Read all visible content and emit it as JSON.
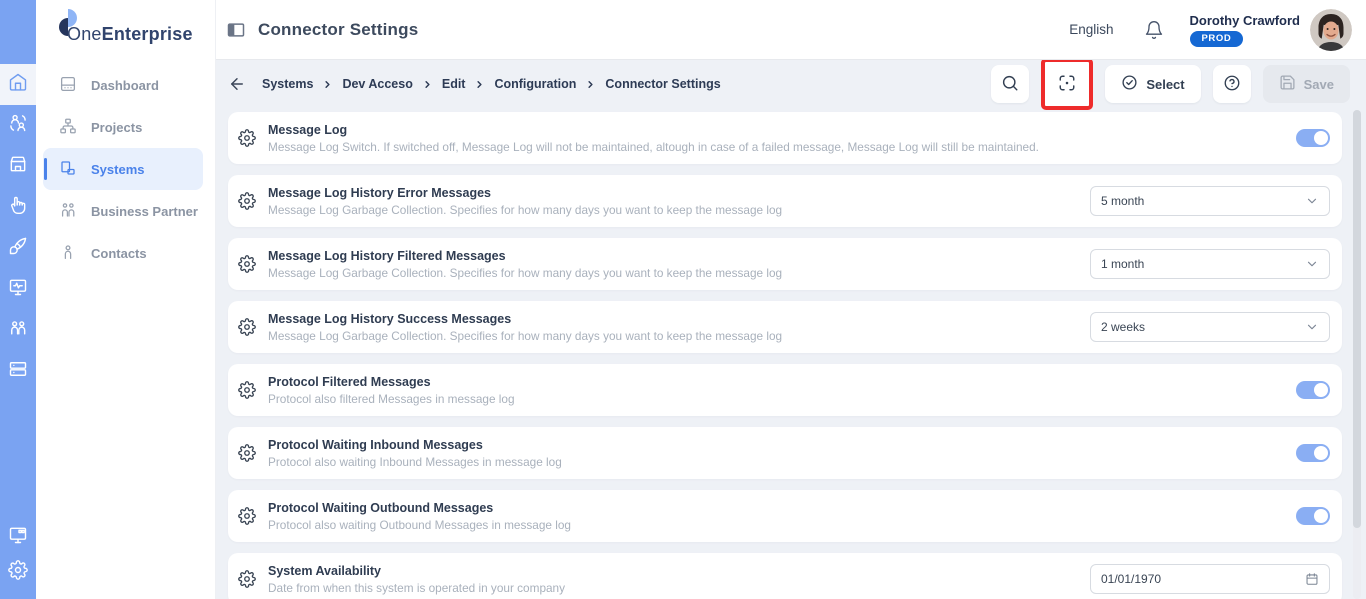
{
  "brand": {
    "name_regular": "One",
    "name_bold": "Enterprise"
  },
  "rail": {
    "items": [
      {
        "icon": "home-icon",
        "active": true
      },
      {
        "icon": "share-users-icon",
        "active": false
      },
      {
        "icon": "store-icon",
        "active": false
      },
      {
        "icon": "hand-pointer-icon",
        "active": false
      },
      {
        "icon": "brush-icon",
        "active": false
      },
      {
        "icon": "monitor-pulse-icon",
        "active": false
      },
      {
        "icon": "users-icon",
        "active": false
      },
      {
        "icon": "server-icon",
        "active": false
      }
    ],
    "bottom_items": [
      {
        "icon": "monitor-apps-icon"
      },
      {
        "icon": "gear-icon"
      }
    ]
  },
  "sidebar": {
    "items": [
      {
        "label": "Dashboard",
        "icon": "dashboard-icon",
        "active": false
      },
      {
        "label": "Projects",
        "icon": "projects-icon",
        "active": false
      },
      {
        "label": "Systems",
        "icon": "systems-icon",
        "active": true
      },
      {
        "label": "Business Partner",
        "icon": "business-partner-icon",
        "active": false
      },
      {
        "label": "Contacts",
        "icon": "contacts-icon",
        "active": false
      }
    ]
  },
  "header": {
    "title": "Connector Settings",
    "language": "English",
    "user": {
      "name": "Dorothy Crawford",
      "badge": "PROD"
    }
  },
  "toolbar": {
    "breadcrumb": [
      "Systems",
      "Dev Acceso",
      "Edit",
      "Configuration",
      "Connector Settings"
    ],
    "select_label": "Select",
    "save_label": "Save",
    "save_disabled": true,
    "annotated_button": "focus-button"
  },
  "settings": {
    "rows": [
      {
        "title": "Message Log",
        "description": "Message Log Switch. If switched off, Message Log will not be maintained, altough in case of a failed message, Message Log will still be maintained.",
        "control": "toggle",
        "value": true
      },
      {
        "title": "Message Log History Error Messages",
        "description": "Message Log Garbage Collection. Specifies for how many days you want to keep the message log",
        "control": "select",
        "value": "5 month"
      },
      {
        "title": "Message Log History Filtered Messages",
        "description": "Message Log Garbage Collection. Specifies for how many days you want to keep the message log",
        "control": "select",
        "value": "1 month"
      },
      {
        "title": "Message Log History Success Messages",
        "description": "Message Log Garbage Collection. Specifies for how many days you want to keep the message log",
        "control": "select",
        "value": "2 weeks"
      },
      {
        "title": "Protocol Filtered Messages",
        "description": "Protocol also filtered Messages in message log",
        "control": "toggle",
        "value": true
      },
      {
        "title": "Protocol Waiting Inbound Messages",
        "description": "Protocol also waiting Inbound Messages in message log",
        "control": "toggle",
        "value": true
      },
      {
        "title": "Protocol Waiting Outbound Messages",
        "description": "Protocol also waiting Outbound Messages in message log",
        "control": "toggle",
        "value": true
      },
      {
        "title": "System Availability",
        "description": "Date from when this system is operated in your company",
        "control": "date",
        "value": "01/01/1970"
      }
    ]
  },
  "colors": {
    "rail_blue": "#7aa3f2",
    "accent_blue": "#4a82ea",
    "toggle_blue": "#8aaef3",
    "badge_blue": "#1568d3",
    "annotation_red": "#ee2b2b",
    "content_bg": "#eef1f6"
  }
}
